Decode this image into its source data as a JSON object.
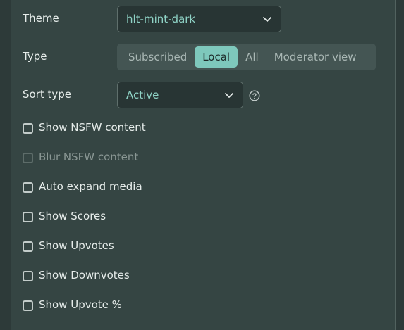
{
  "theme": {
    "label": "Theme",
    "value": "hlt-mint-dark"
  },
  "type": {
    "label": "Type",
    "options": [
      "Subscribed",
      "Local",
      "All",
      "Moderator view"
    ],
    "selected": "Local"
  },
  "sort": {
    "label": "Sort type",
    "value": "Active"
  },
  "checkboxes": [
    {
      "label": "Show NSFW content",
      "checked": false,
      "disabled": false
    },
    {
      "label": "Blur NSFW content",
      "checked": false,
      "disabled": true
    },
    {
      "label": "Auto expand media",
      "checked": false,
      "disabled": false
    },
    {
      "label": "Show Scores",
      "checked": false,
      "disabled": false
    },
    {
      "label": "Show Upvotes",
      "checked": false,
      "disabled": false
    },
    {
      "label": "Show Downvotes",
      "checked": false,
      "disabled": false
    },
    {
      "label": "Show Upvote %",
      "checked": false,
      "disabled": false
    }
  ],
  "colors": {
    "accent": "#7ec8bc",
    "background": "#2d3a39",
    "panel": "#354543"
  }
}
